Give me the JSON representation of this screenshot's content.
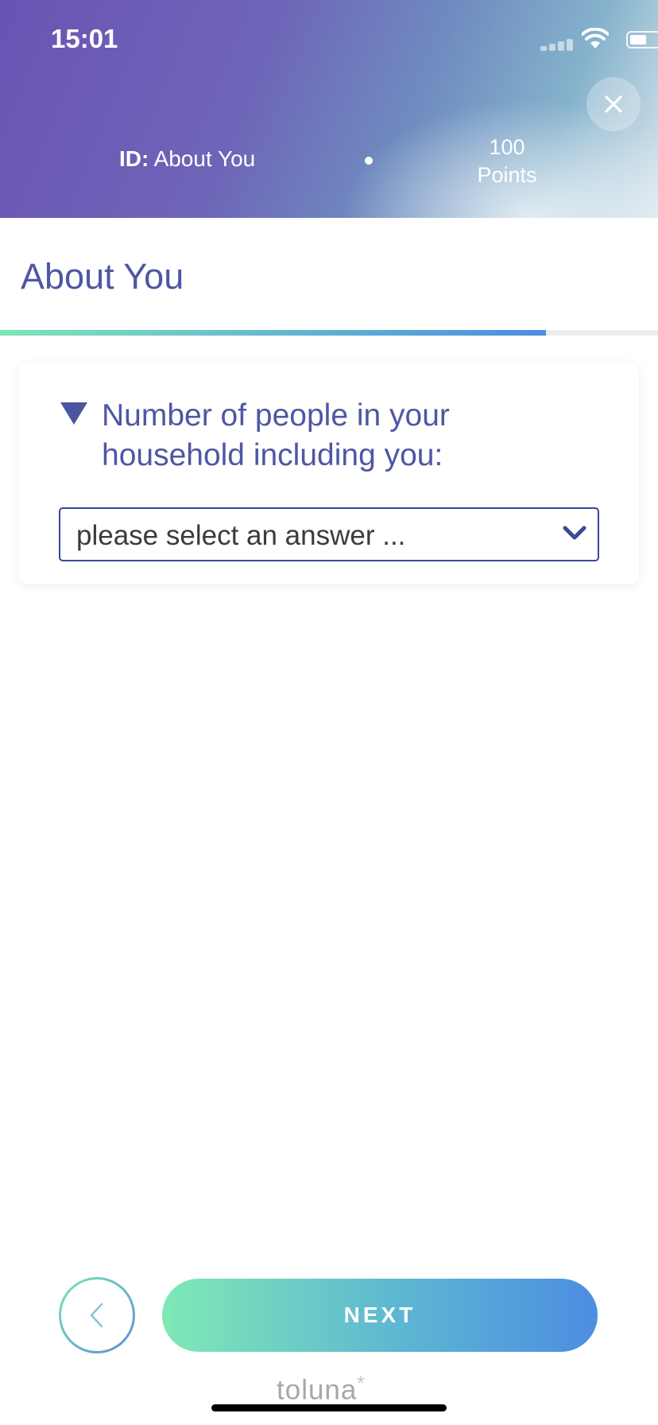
{
  "status_bar": {
    "time": "15:01"
  },
  "header": {
    "id_label": "ID:",
    "id_value": "About You",
    "points_value": "100",
    "points_label": "Points"
  },
  "page": {
    "title": "About You",
    "progress_fraction": 0.83
  },
  "question": {
    "text": "Number of people in your household including you:",
    "select_placeholder": "please select an answer ..."
  },
  "footer": {
    "next_label": "NEXT",
    "logo_text": "toluna",
    "logo_mark": "*"
  },
  "colors": {
    "accent": "#4e57a3",
    "select_border": "#3c4796",
    "button_gradient_start": "#7fe9b5",
    "button_gradient_end": "#4c8de2"
  },
  "icons": [
    "signal-icon",
    "wifi-icon",
    "battery-icon",
    "close-icon",
    "triangle-down-icon",
    "chevron-down-icon",
    "chevron-left-icon"
  ]
}
